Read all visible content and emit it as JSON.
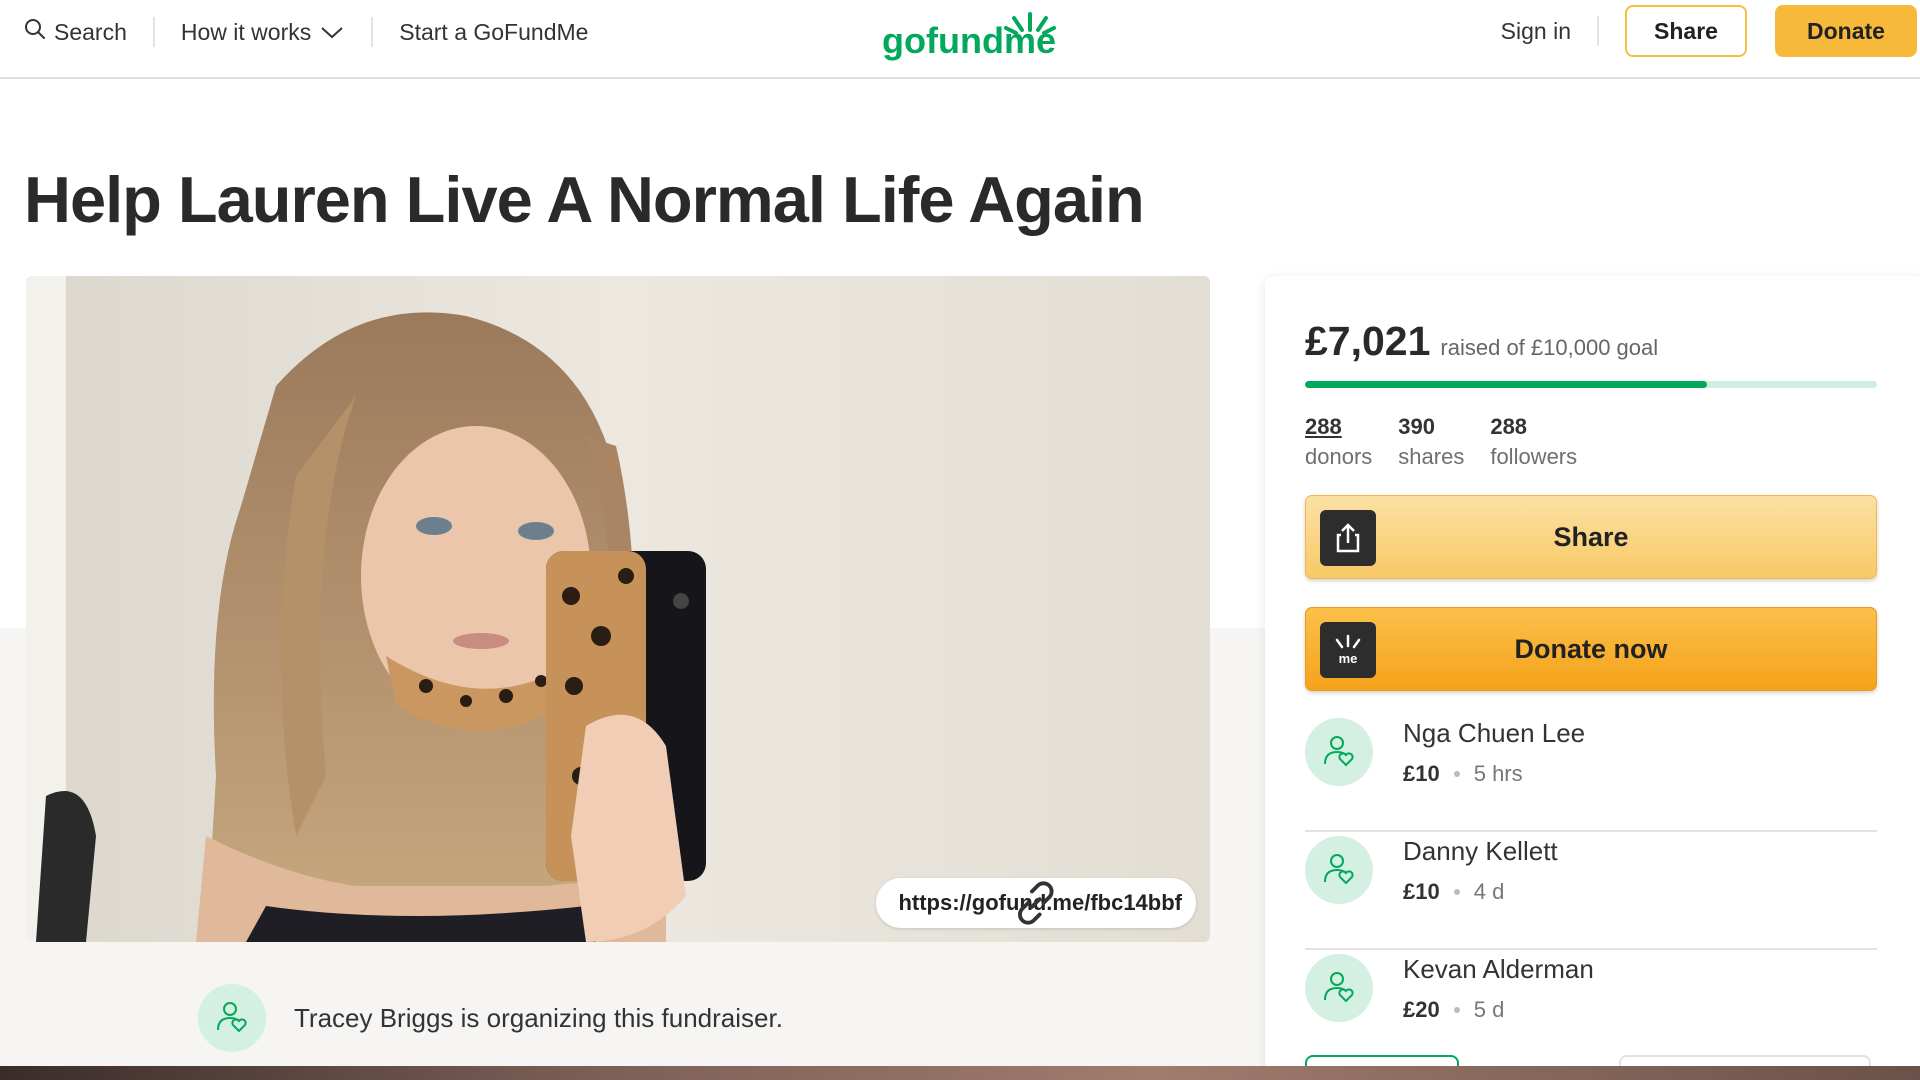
{
  "header": {
    "search_label": "Search",
    "how_it_works_label": "How it works",
    "start_label": "Start a GoFundMe",
    "logo_text": "gofundme",
    "signin_label": "Sign in",
    "share_label": "Share",
    "donate_label": "Donate"
  },
  "campaign": {
    "title": "Help Lauren Live A Normal Life Again",
    "short_url": "https://gofund.me/fbc14bbf",
    "organizer_text": "Tracey Briggs is organizing this fundraiser."
  },
  "summary": {
    "raised": "£7,021",
    "goal_text": "raised of £10,000 goal",
    "progress_percent": 70.21,
    "stats": [
      {
        "value": "288",
        "label": "donors"
      },
      {
        "value": "390",
        "label": "shares"
      },
      {
        "value": "288",
        "label": "followers"
      }
    ],
    "share_button": "Share",
    "donate_button": "Donate now"
  },
  "donations": [
    {
      "name": "Nga Chuen Lee",
      "amount": "£10",
      "time": "5 hrs"
    },
    {
      "name": "Danny Kellett",
      "amount": "£10",
      "time": "4 d"
    },
    {
      "name": "Kevan Alderman",
      "amount": "£20",
      "time": "5 d"
    }
  ],
  "colors": {
    "brand_green": "#02a95c",
    "donate_yellow": "#f6b93a",
    "progress_track": "#cdeee0"
  },
  "icons": {
    "search": "search-icon",
    "chevron": "chevron-down-icon",
    "link": "link-icon",
    "share": "share-upload-icon",
    "donate": "gofundme-sprout-icon",
    "donor_avatar": "person-heart-icon"
  }
}
